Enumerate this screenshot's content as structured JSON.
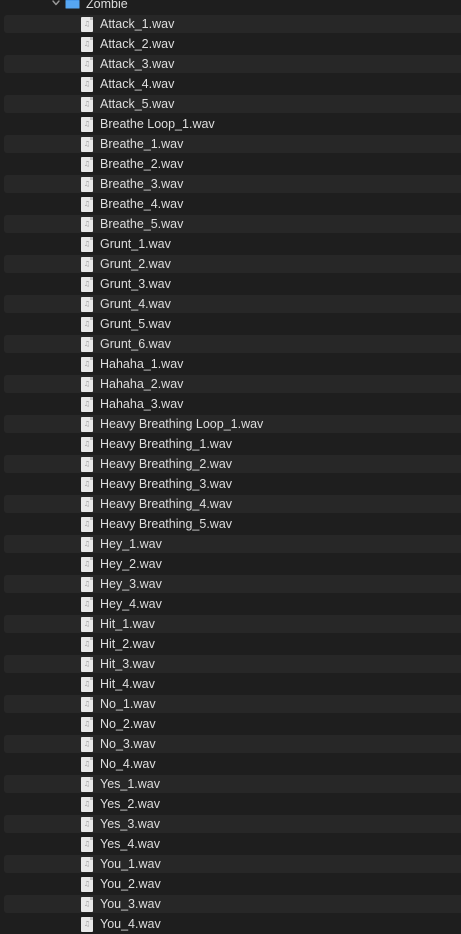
{
  "folder": {
    "name": "Zombie",
    "icon": "folder-icon",
    "expanded": true,
    "accent_color": "#3a8ee6"
  },
  "files": [
    "Attack_1.wav",
    "Attack_2.wav",
    "Attack_3.wav",
    "Attack_4.wav",
    "Attack_5.wav",
    "Breathe Loop_1.wav",
    "Breathe_1.wav",
    "Breathe_2.wav",
    "Breathe_3.wav",
    "Breathe_4.wav",
    "Breathe_5.wav",
    "Grunt_1.wav",
    "Grunt_2.wav",
    "Grunt_3.wav",
    "Grunt_4.wav",
    "Grunt_5.wav",
    "Grunt_6.wav",
    "Hahaha_1.wav",
    "Hahaha_2.wav",
    "Hahaha_3.wav",
    "Heavy Breathing Loop_1.wav",
    "Heavy Breathing_1.wav",
    "Heavy Breathing_2.wav",
    "Heavy Breathing_3.wav",
    "Heavy Breathing_4.wav",
    "Heavy Breathing_5.wav",
    "Hey_1.wav",
    "Hey_2.wav",
    "Hey_3.wav",
    "Hey_4.wav",
    "Hit_1.wav",
    "Hit_2.wav",
    "Hit_3.wav",
    "Hit_4.wav",
    "No_1.wav",
    "No_2.wav",
    "No_3.wav",
    "No_4.wav",
    "Yes_1.wav",
    "Yes_2.wav",
    "Yes_3.wav",
    "Yes_4.wav",
    "You_1.wav",
    "You_2.wav",
    "You_3.wav",
    "You_4.wav"
  ],
  "file_icon": "audio-file-icon"
}
